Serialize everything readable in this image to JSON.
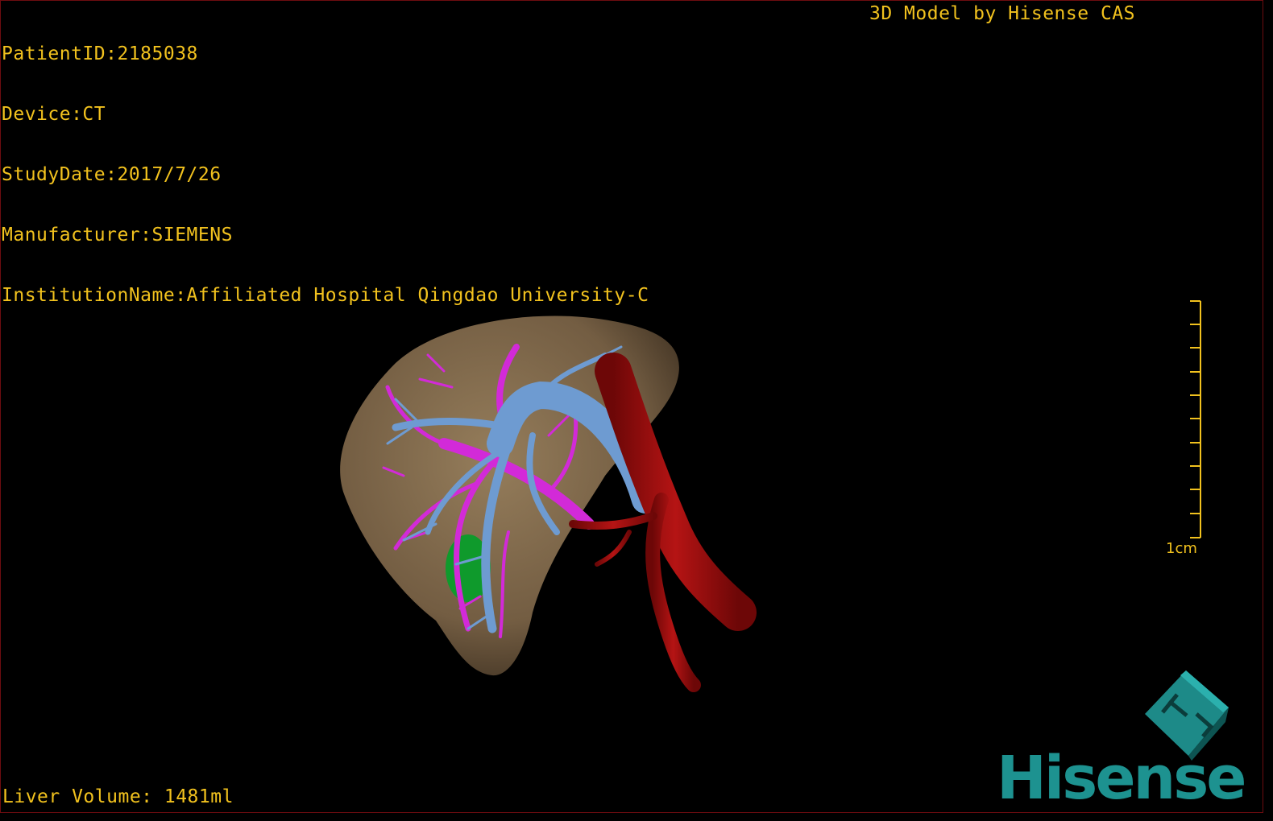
{
  "info": {
    "patient_id": "PatientID:2185038",
    "device": "Device:CT",
    "study_date": "StudyDate:2017/7/26",
    "manufacturer": "Manufacturer:SIEMENS",
    "institution": "InstitutionName:Affiliated Hospital Qingdao University-C"
  },
  "title": "3D Model by Hisense CAS",
  "scale_bar": {
    "label": "1cm"
  },
  "liver_volume": "Liver Volume: 1481ml",
  "brand": "Hisense",
  "colors": {
    "overlay_text": "#f2c21e",
    "liver": "#8a7152",
    "portal_vein": "#6e9bd1",
    "hepatic_vein": "#d22ad8",
    "artery": "#9c0e0e",
    "gallbladder": "#0f9a2c",
    "brand": "#1d9290"
  }
}
